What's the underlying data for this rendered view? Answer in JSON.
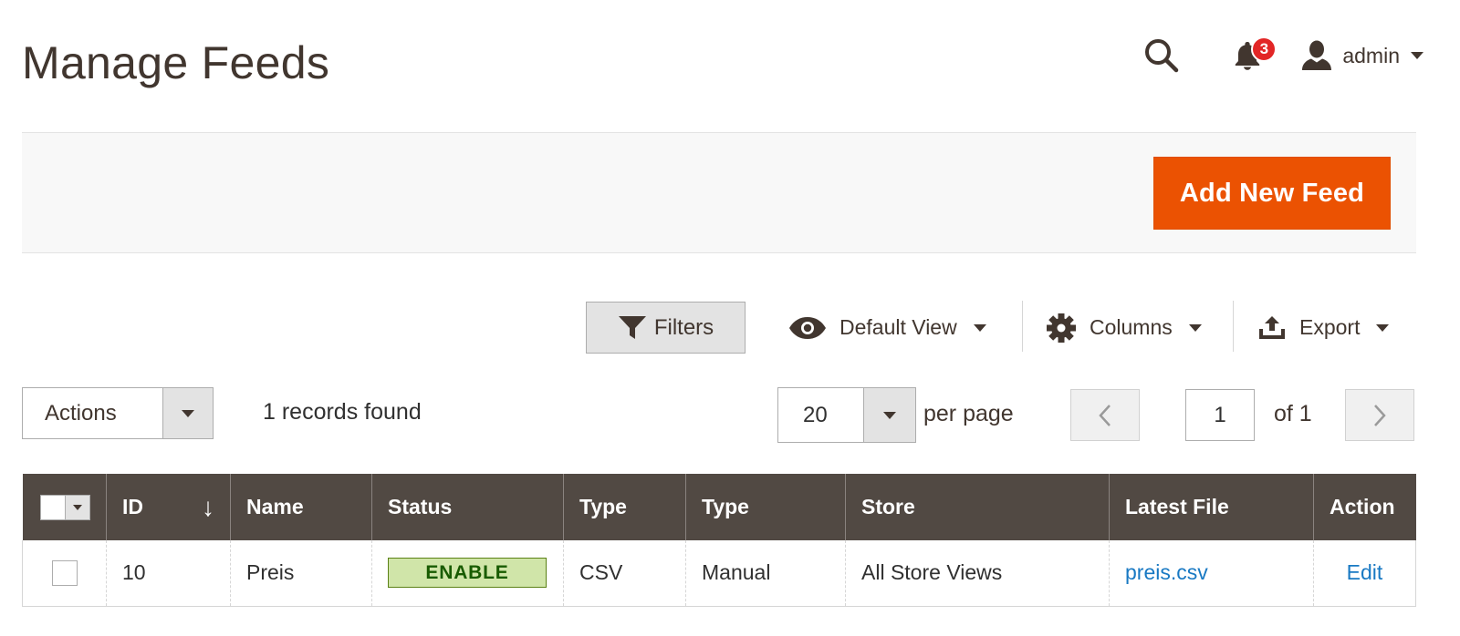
{
  "page": {
    "title": "Manage Feeds"
  },
  "header": {
    "search_icon": "search-icon",
    "notifications": {
      "icon": "bell-icon",
      "count": "3"
    },
    "user": {
      "icon": "user-icon",
      "name": "admin"
    }
  },
  "actions": {
    "add_button": "Add New Feed"
  },
  "toolbar": {
    "filters_label": "Filters",
    "view_label": "Default View",
    "columns_label": "Columns",
    "export_label": "Export"
  },
  "massactions": {
    "label": "Actions"
  },
  "records": {
    "text": "1 records found"
  },
  "paging": {
    "per_page_value": "20",
    "per_page_label": "per page",
    "current_page": "1",
    "total_label": "of 1"
  },
  "grid": {
    "columns": [
      "ID",
      "Name",
      "Status",
      "Type",
      "Type",
      "Store",
      "Latest File",
      "Action"
    ],
    "sort_arrow": "↓",
    "rows": [
      {
        "id": "10",
        "name": "Preis",
        "status": "ENABLE",
        "type": "CSV",
        "mode": "Manual",
        "store": "All Store Views",
        "latest_file": "preis.csv",
        "action": "Edit"
      }
    ]
  },
  "colors": {
    "primary": "#eb5202",
    "header_bg": "#514943",
    "link": "#1979c3",
    "status_bg": "#d0e5a9",
    "status_text": "#185b00",
    "badge": "#e22626"
  }
}
